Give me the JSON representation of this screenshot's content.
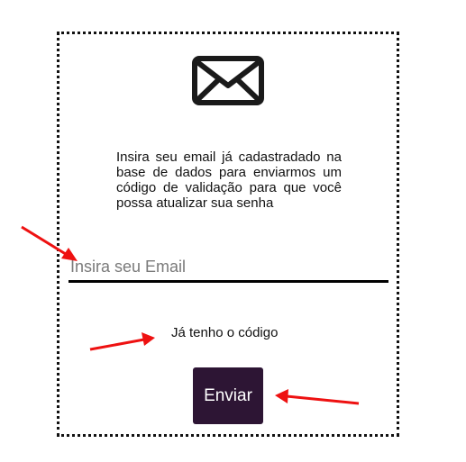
{
  "card": {
    "icon": "envelope-icon",
    "description": "Insira seu email já cadastradado na base de dados para enviarmos um código de validação para que você possa atualizar sua senha",
    "email": {
      "placeholder": "Insira seu Email",
      "value": ""
    },
    "code_link_label": "Já tenho o código",
    "submit_label": "Enviar"
  },
  "annotations": {
    "arrow_icon": "arrow-icon",
    "arrow_color": "#ee1111"
  },
  "colors": {
    "button_background": "#2d1534",
    "button_text": "#ffffff",
    "border": "#111111"
  }
}
